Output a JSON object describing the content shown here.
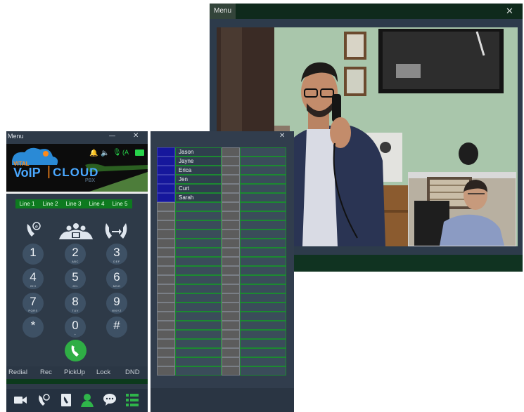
{
  "video_window": {
    "menu_label": "Menu",
    "close_label": "✕"
  },
  "phone": {
    "menu_label": "Menu",
    "minimize_label": "—",
    "close_label": "✕",
    "brand": {
      "line1": "VITAL",
      "line2a": "VoIP",
      "line2b": "CLOUD",
      "line3": "PBX"
    },
    "lines": [
      "Line 1",
      "Line 2",
      "Line 3",
      "Line 4",
      "Line 5"
    ],
    "keys": [
      {
        "d": "1",
        "l": ""
      },
      {
        "d": "2",
        "l": "ABC"
      },
      {
        "d": "3",
        "l": "DEF"
      },
      {
        "d": "4",
        "l": "GHI"
      },
      {
        "d": "5",
        "l": "JKL"
      },
      {
        "d": "6",
        "l": "MNO"
      },
      {
        "d": "7",
        "l": "PQRS"
      },
      {
        "d": "8",
        "l": "TUV"
      },
      {
        "d": "9",
        "l": "WXYZ"
      },
      {
        "d": "*",
        "l": ""
      },
      {
        "d": "0",
        "l": "+"
      },
      {
        "d": "#",
        "l": ""
      }
    ],
    "actions": [
      "Redial",
      "Rec",
      "PickUp",
      "Lock",
      "DND"
    ],
    "status_mini": "(A",
    "colors": {
      "accent_green": "#2fae45",
      "panel": "#2e3a48"
    }
  },
  "contacts": {
    "close_label": "✕",
    "names": [
      "Jason",
      "Jayne",
      "Erica",
      "Jen",
      "Curt",
      "Sarah"
    ],
    "rows": 25
  }
}
